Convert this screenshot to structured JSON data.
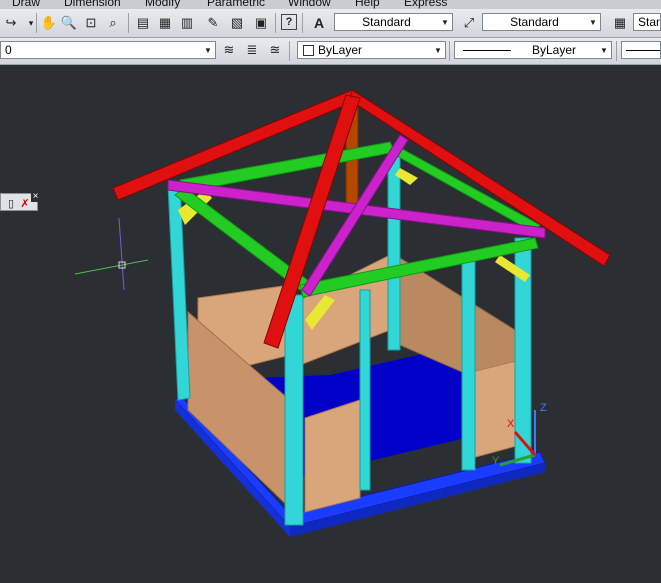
{
  "menu": {
    "items": [
      "Draw",
      "Dimension",
      "Modify",
      "Parametric",
      "Window",
      "Help",
      "Express"
    ]
  },
  "toolbar1": {
    "icons": [
      "redo-icon",
      "pan-icon",
      "zoom-realtime-icon",
      "zoom-window-icon",
      "zoom-previous-icon",
      "properties-icon",
      "design-center-icon",
      "tool-palettes-icon",
      "markup-icon",
      "calculator-icon",
      "help-icon"
    ],
    "text_style_label": "Standard",
    "dim_style_label": "Standard",
    "table_style_label": "Stan"
  },
  "toolbar2": {
    "layer_value": "0",
    "color_value": "ByLayer",
    "linetype_value": "ByLayer"
  },
  "viewport": {
    "ucs_labels": {
      "x": "X",
      "y": "Y",
      "z": "Z"
    }
  },
  "palette": {
    "close_label": "×"
  },
  "colors": {
    "background": "#2b2f33",
    "roof_ridge": "#e01010",
    "hip_rafter": "#cc22cc",
    "purlin": "#22cc22",
    "post": "#33d6d6",
    "brace": "#e8e832",
    "wall_panel": "#d9a57a",
    "floor": "#0000c8",
    "base": "#1a3cff"
  }
}
